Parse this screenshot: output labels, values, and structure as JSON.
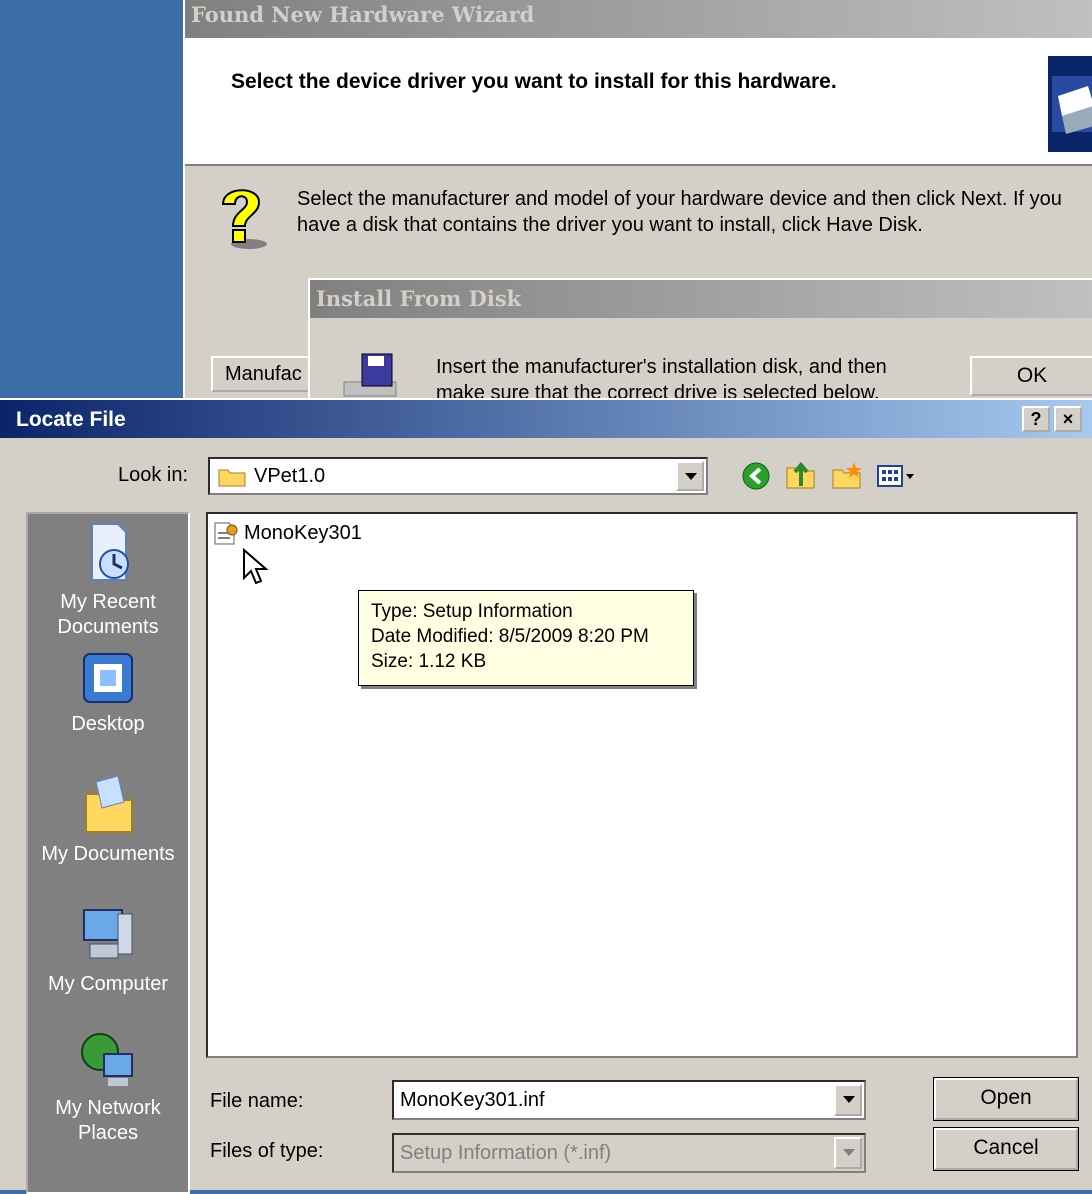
{
  "wizard": {
    "title": "Found New Hardware Wizard",
    "heading": "Select the device driver you want to install for this hardware.",
    "instruction_line1": "Select the manufacturer and model of your hardware device and then click Next. If you",
    "instruction_line2": "have a disk that contains the driver you want to install, click Have Disk.",
    "manufacturer_button": "Manufac"
  },
  "install_from_disk": {
    "title": "Install From Disk",
    "text_line1": "Insert the manufacturer's installation disk, and then",
    "text_line2": "make sure that the correct drive is selected below.",
    "ok_button": "OK"
  },
  "locate_file": {
    "title": "Locate File",
    "help_button": "?",
    "close_button": "×",
    "look_in_label": "Look in:",
    "look_in_value": "VPet1.0",
    "toolbar_icons": [
      "back-icon",
      "up-folder-icon",
      "new-folder-icon",
      "view-menu-icon"
    ],
    "places": [
      {
        "line1": "My Recent",
        "line2": "Documents"
      },
      {
        "line1": "Desktop",
        "line2": ""
      },
      {
        "line1": "My Documents",
        "line2": ""
      },
      {
        "line1": "My Computer",
        "line2": ""
      },
      {
        "line1": "My Network",
        "line2": "Places"
      }
    ],
    "files": [
      {
        "name": "MonoKey301"
      }
    ],
    "tooltip": {
      "type": "Type: Setup Information",
      "date": "Date Modified: 8/5/2009 8:20 PM",
      "size": "Size: 1.12 KB"
    },
    "file_name_label": "File name:",
    "file_name_value": "MonoKey301.inf",
    "files_of_type_label": "Files of type:",
    "files_of_type_value": "Setup Information (*.inf)",
    "open_button": "Open",
    "cancel_button": "Cancel"
  },
  "colors": {
    "desktop": "#3a6ea5",
    "dialog_face": "#d4d0c8",
    "active_title": "#0a246a",
    "tooltip_bg": "#ffffe1"
  }
}
